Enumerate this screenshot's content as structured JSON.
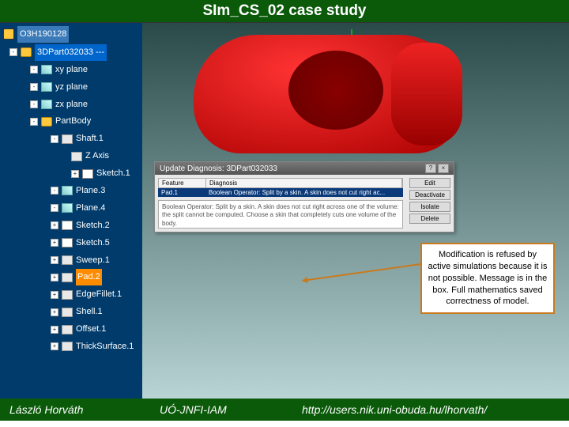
{
  "header": {
    "title": "SIm_CS_02 case study"
  },
  "tree": {
    "root": "O3H190128",
    "part": "3DPart032033 ---",
    "items": [
      "xy plane",
      "yz plane",
      "zx plane"
    ],
    "body": "PartBody",
    "features": {
      "shaft": "Shaft.1",
      "zaxis": "Z Axis",
      "sketch1": "Sketch.1",
      "plane3": "Plane.3",
      "plane4": "Plane.4",
      "sketch2": "Sketch.2",
      "sketch5": "Sketch.5",
      "sweep1": "Sweep.1",
      "pad2": "Pad.2",
      "edgefillet": "EdgeFillet.1",
      "shell1": "Shell.1",
      "offset1": "Offset.1",
      "thick": "ThickSurface.1"
    }
  },
  "dialog": {
    "title": "Update Diagnosis: 3DPart032033",
    "col1": "Feature",
    "col2": "Diagnosis",
    "row_feature": "Pad.1",
    "row_diag": "Boolean Operator: Split by a skin. A skin does not cut right ac...",
    "msg": "Boolean Operator: Split by a skin.\nA skin does not cut right across one of the volume: the split cannot be computed.\nChoose a skin that completely cuts one volume of the body.",
    "btn_edit": "Edit",
    "btn_deact": "Deactivate",
    "btn_isolate": "Isolate",
    "btn_delete": "Delete"
  },
  "annotation": "Modification is refused by active simulations because it is not possible. Message is in the box. Full mathematics saved correctness of model.",
  "footer": {
    "author": "László Horváth",
    "inst": "UÓ-JNFI-IAM",
    "url": "http://users.nik.uni-obuda.hu/lhorvath/"
  }
}
